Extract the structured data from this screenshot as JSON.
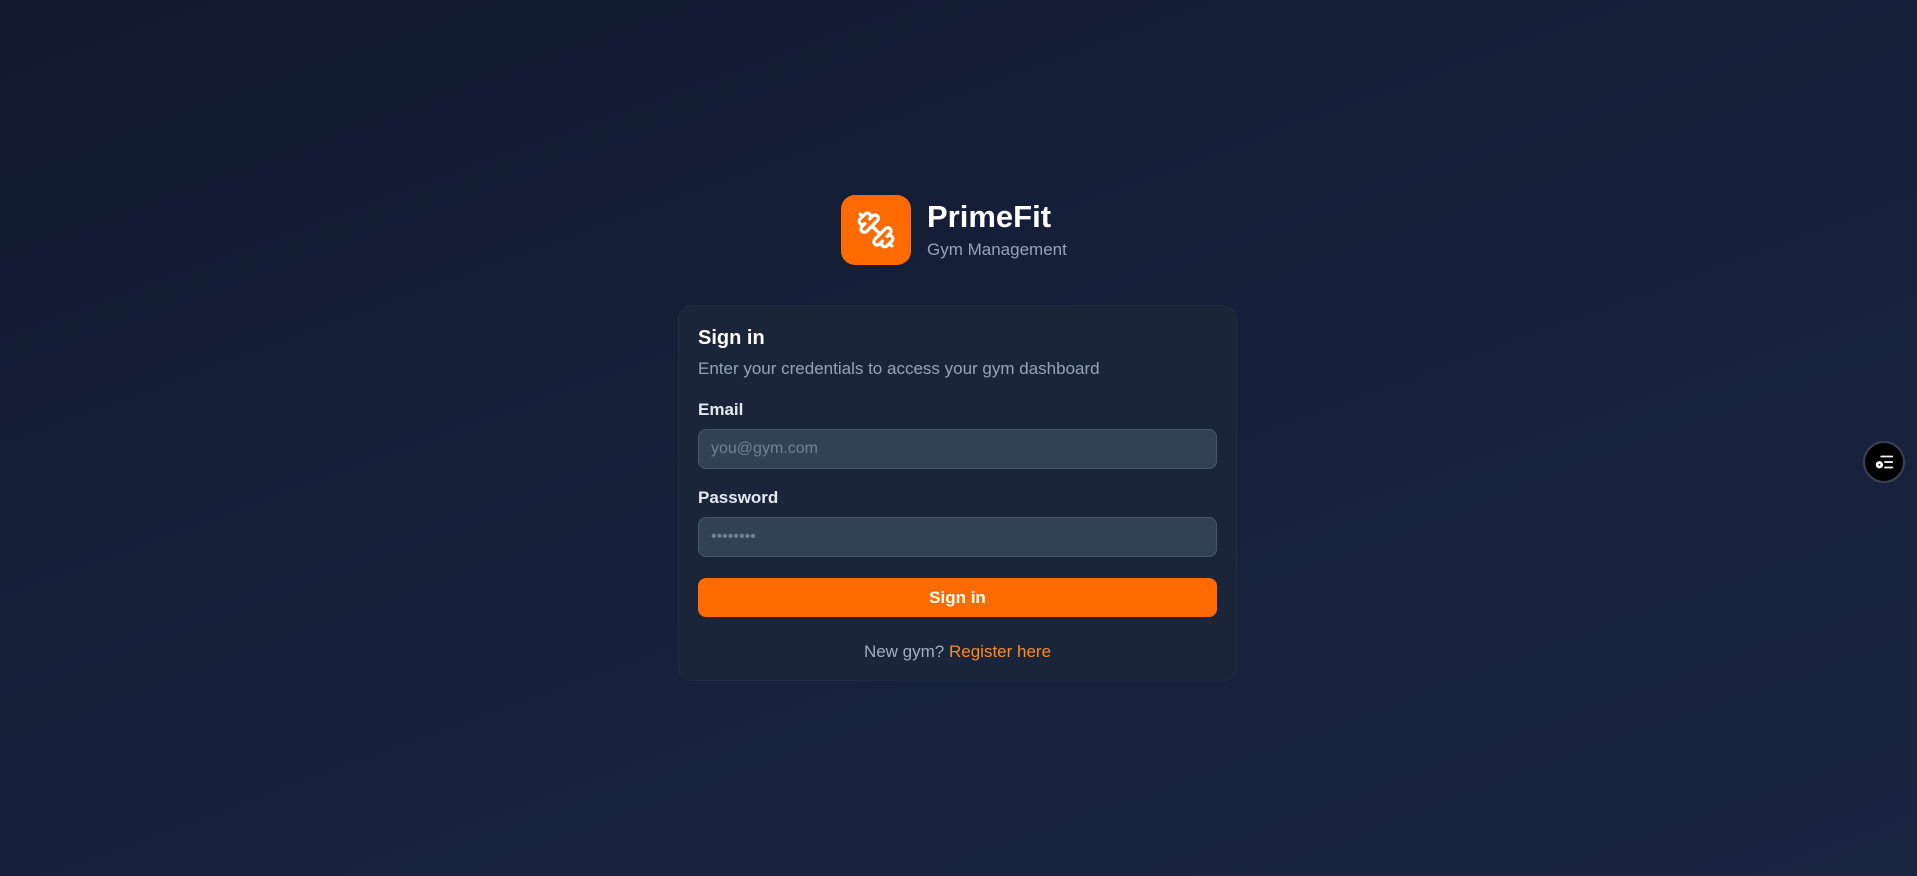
{
  "brand": {
    "name": "PrimeFit",
    "tagline": "Gym Management",
    "logo_icon": "dumbbell-icon",
    "accent_color": "#ff6b00"
  },
  "card": {
    "title": "Sign in",
    "subtitle": "Enter your credentials to access your gym dashboard",
    "email": {
      "label": "Email",
      "value": "",
      "placeholder": "you@gym.com"
    },
    "password": {
      "label": "Password",
      "value": "",
      "placeholder": "••••••••"
    },
    "submit_label": "Sign in",
    "register_prompt": "New gym?",
    "register_link": "Register here"
  },
  "floating_button": {
    "icon": "list-settings-icon"
  },
  "colors": {
    "background": "#131c33",
    "card": "#1b253a",
    "input": "#334157",
    "link": "#ff8a1f"
  }
}
